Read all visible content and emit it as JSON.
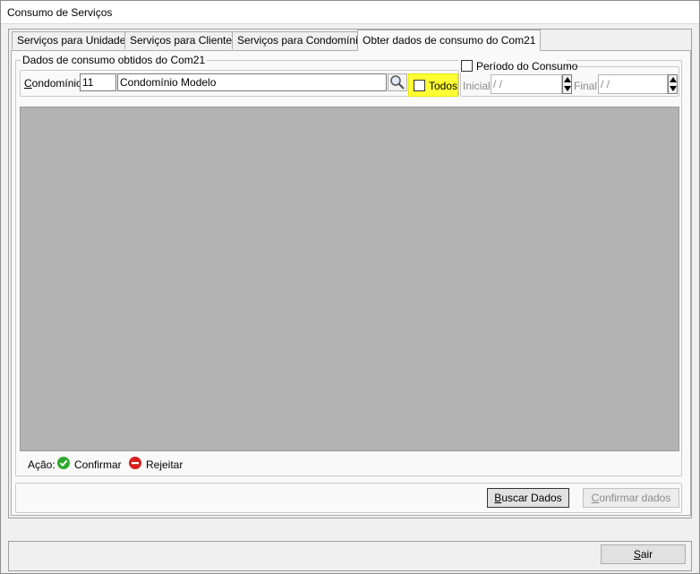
{
  "window": {
    "title": "Consumo de Serviços"
  },
  "tabs": [
    {
      "label": "Serviços para Unidades"
    },
    {
      "label": "Serviços para Clientes"
    },
    {
      "label": "Serviços para Condomínios"
    },
    {
      "label": "Obter dados de consumo do Com21"
    }
  ],
  "group": {
    "title": "Dados de consumo obtidos do Com21"
  },
  "condominio": {
    "label_first": "C",
    "label_rest": "ondomínio:",
    "code": "11",
    "name": "Condomínio Modelo"
  },
  "todos": {
    "label": "Todos"
  },
  "periodo": {
    "title": "Período do Consumo",
    "inicial_label": "Inicial:",
    "inicial_value": " /  /",
    "final_label": "Final:",
    "final_value": " /  /"
  },
  "legend": {
    "label": "Ação:",
    "confirm": "Confirmar",
    "reject": "Rejeitar"
  },
  "buttons": {
    "buscar_first": "B",
    "buscar_rest": "uscar Dados",
    "confirmar_first": "C",
    "confirmar_rest": "onfirmar dados",
    "sair_first": "S",
    "sair_rest": "air"
  },
  "colors": {
    "highlight": "#ffff33",
    "confirm_icon": "#2fa82f",
    "reject_icon": "#d81e1e",
    "grid_bg": "#b3b3b3"
  }
}
